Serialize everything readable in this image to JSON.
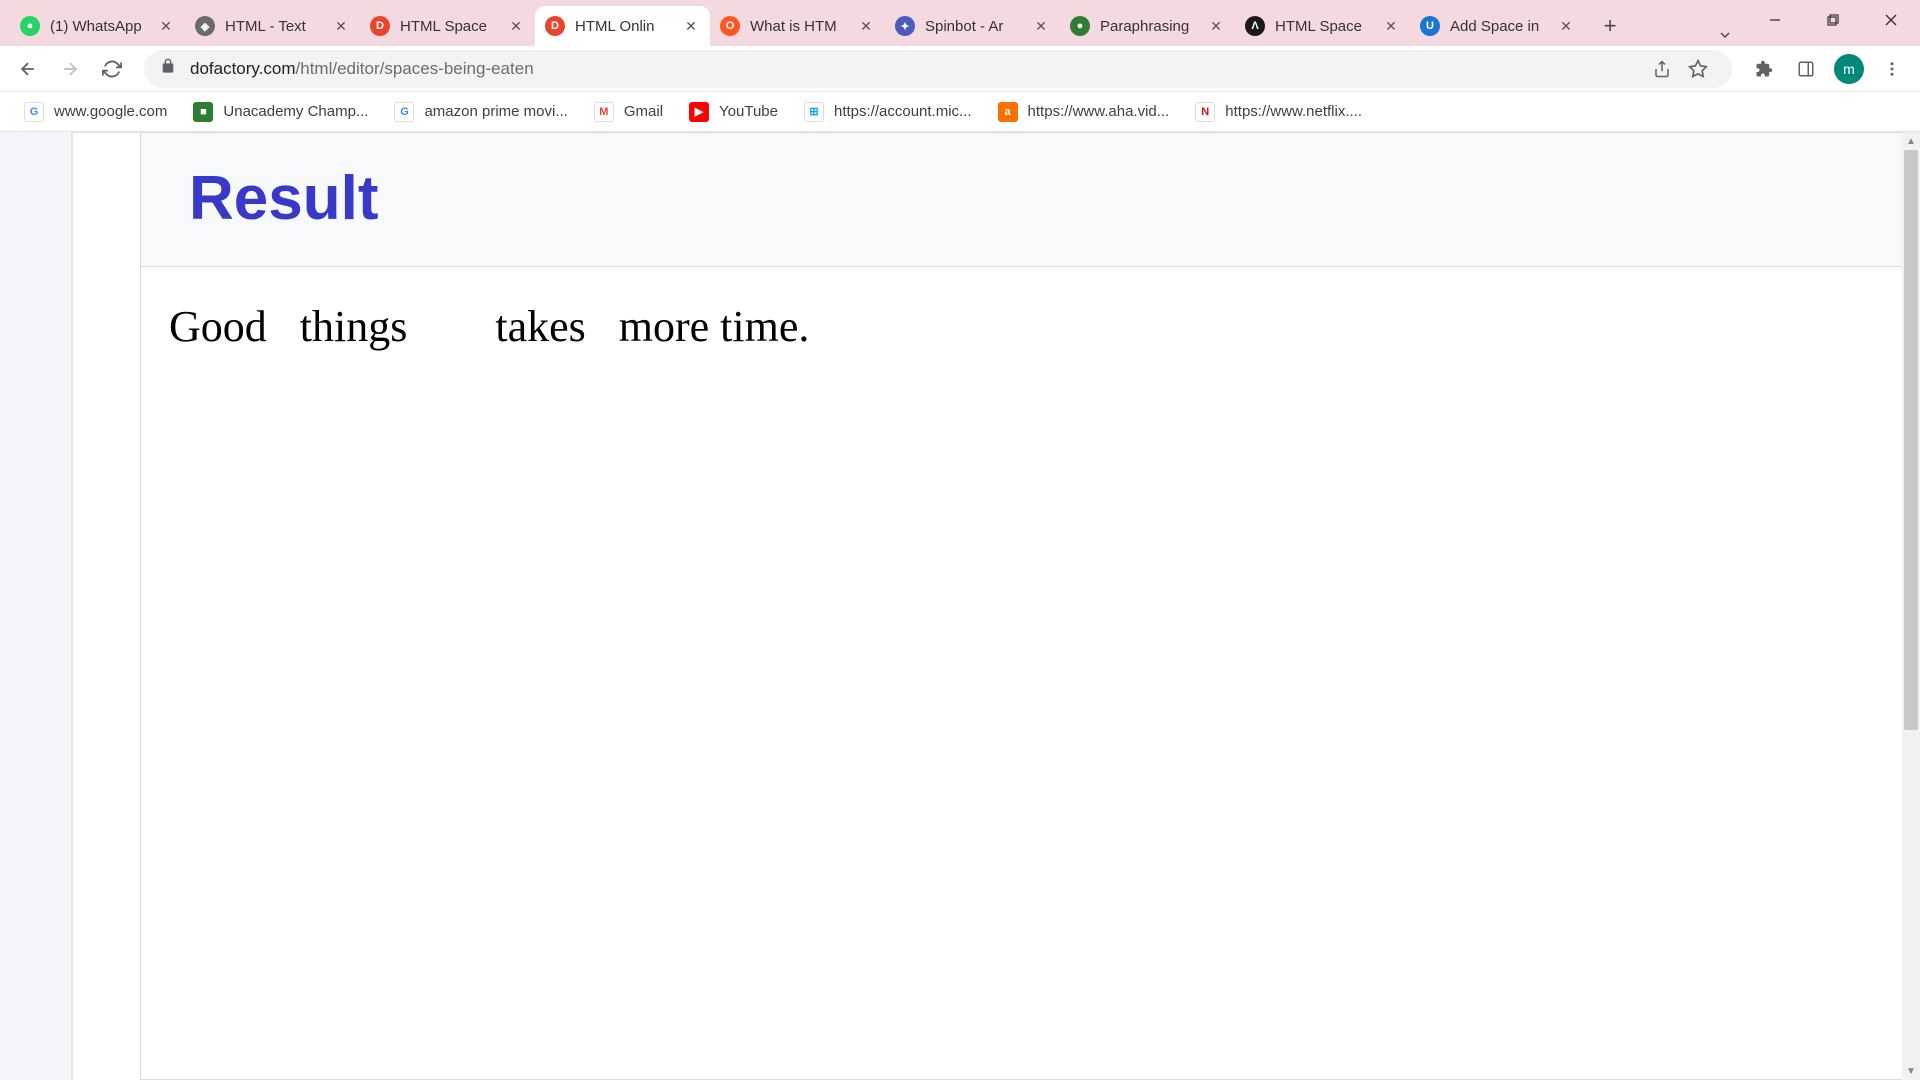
{
  "tabs": [
    {
      "title": "(1) WhatsApp",
      "favicon_bg": "#25d366",
      "favicon_text": "●"
    },
    {
      "title": "HTML - Text",
      "favicon_bg": "#555",
      "favicon_text": "◈"
    },
    {
      "title": "HTML Space",
      "favicon_bg": "#e8442e",
      "favicon_text": "D"
    },
    {
      "title": "HTML Onlin",
      "favicon_bg": "#e8442e",
      "favicon_text": "D",
      "active": true
    },
    {
      "title": "What is HTM",
      "favicon_bg": "#ff5722",
      "favicon_text": "O"
    },
    {
      "title": "Spinbot - Ar",
      "favicon_bg": "#4a5bb8",
      "favicon_text": "✦"
    },
    {
      "title": "Paraphrasing",
      "favicon_bg": "#2e7d32",
      "favicon_text": "●"
    },
    {
      "title": "HTML Space",
      "favicon_bg": "#1a1a1a",
      "favicon_text": "Λ"
    },
    {
      "title": "Add Space in",
      "favicon_bg": "#1976d2",
      "favicon_text": "U"
    }
  ],
  "address": {
    "domain": "dofactory.com",
    "path": "/html/editor/spaces-being-eaten"
  },
  "bookmarks": [
    {
      "label": "www.google.com",
      "icon_bg": "#ffffff",
      "icon_text": "G",
      "icon_color": "#4285f4"
    },
    {
      "label": "Unacademy Champ...",
      "icon_bg": "#2e7d32",
      "icon_text": "■",
      "icon_color": "#fff"
    },
    {
      "label": "amazon prime movi...",
      "icon_bg": "#ffffff",
      "icon_text": "G",
      "icon_color": "#4285f4"
    },
    {
      "label": "Gmail",
      "icon_bg": "#ffffff",
      "icon_text": "M",
      "icon_color": "#ea4335"
    },
    {
      "label": "YouTube",
      "icon_bg": "#ff0000",
      "icon_text": "▶",
      "icon_color": "#fff"
    },
    {
      "label": "https://account.mic...",
      "icon_bg": "#ffffff",
      "icon_text": "⊞",
      "icon_color": "#00a4ef"
    },
    {
      "label": "https://www.aha.vid...",
      "icon_bg": "#ff6f00",
      "icon_text": "a",
      "icon_color": "#fff"
    },
    {
      "label": "https://www.netflix....",
      "icon_bg": "#ffffff",
      "icon_text": "N",
      "icon_color": "#e50914"
    }
  ],
  "profile_initial": "m",
  "page": {
    "result_heading": "Result",
    "result_text": "Good   things        takes   more time."
  }
}
